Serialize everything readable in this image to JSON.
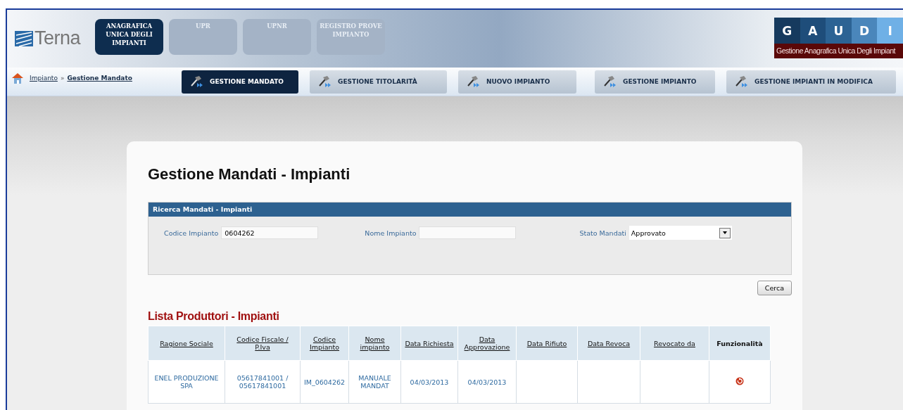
{
  "header": {
    "logo_text": "Terna",
    "tabs": [
      {
        "label": "ANAGRAFICA UNICA DEGLI IMPIANTI",
        "selected": true
      },
      {
        "label": "UPR",
        "selected": false
      },
      {
        "label": "UPNR",
        "selected": false
      },
      {
        "label": "REGISTRO PROVE IMPIANTO",
        "selected": false
      }
    ],
    "brand": {
      "letters": [
        "G",
        "A",
        "U",
        "D",
        "I"
      ],
      "subtitle": "Gestione Anagrafica Unica Degli Impiant"
    }
  },
  "breadcrumb": [
    {
      "label": "Impianto",
      "current": false
    },
    {
      "label": "Gestione Mandato",
      "current": true
    }
  ],
  "breadcrumb_separator": "»",
  "nav_buttons": [
    {
      "label": "GESTIONE MANDATO",
      "selected": true
    },
    {
      "label": "GESTIONE TITOLARITÀ",
      "selected": false
    },
    {
      "label": "NUOVO IMPIANTO",
      "selected": false
    },
    {
      "label": "GESTIONE IMPIANTO",
      "selected": false
    },
    {
      "label": "GESTIONE IMPIANTI IN MODIFICA",
      "selected": false
    }
  ],
  "page_title": "Gestione Mandati - Impianti",
  "search": {
    "title": "Ricerca Mandati - Impianti",
    "fields": [
      {
        "kind": "text",
        "label": "Codice Impianto",
        "value": "0604262"
      },
      {
        "kind": "text",
        "label": "Nome Impianto"
      },
      {
        "kind": "select",
        "label": "Stato Mandati",
        "value": "Approvato"
      }
    ],
    "button": "Cerca"
  },
  "list_title": "Lista Produttori - Impianti",
  "table": {
    "columns": [
      {
        "label": "Ragione Sociale",
        "link": true
      },
      {
        "label": "Codice Fiscale / P.Iva",
        "link": true
      },
      {
        "label": "Codice Impianto",
        "link": true
      },
      {
        "label": "Nome impianto",
        "link": true
      },
      {
        "label": "Data Richiesta",
        "link": true
      },
      {
        "label": "Data Approvazione",
        "link": true
      },
      {
        "label": "Data Rifiuto",
        "link": true
      },
      {
        "label": "Data Revoca",
        "link": true
      },
      {
        "label": "Revocato da",
        "link": true
      },
      {
        "label": "Funzionalità",
        "link": false
      }
    ],
    "rows": [
      {
        "cells": [
          "ENEL PRODUZIONE SPA",
          "05617841001 / 05617841001",
          "IM_0604262",
          "MANUALE MANDAT",
          "04/03/2013",
          "04/03/2013",
          "",
          "",
          "",
          ""
        ],
        "has_action": true
      }
    ]
  }
}
